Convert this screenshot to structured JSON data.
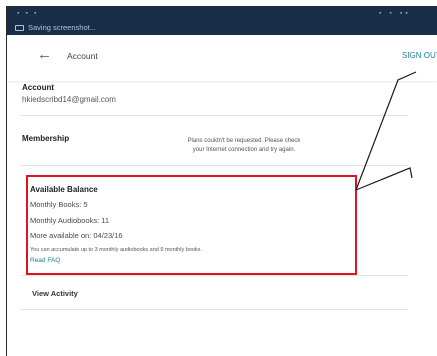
{
  "statusbar": {
    "notification_text": "Saving screenshot..."
  },
  "appbar": {
    "title": "Account",
    "sign_out_label": "SIGN OUT"
  },
  "account": {
    "label": "Account",
    "email": "hkiedscribd14@gmail.com"
  },
  "membership": {
    "label": "Membership",
    "message_line1": "Plans couldn't be requested. Please check",
    "message_line2": "your Internet connection and try again."
  },
  "balance": {
    "title": "Available Balance",
    "monthly_books": "Monthly Books: 5",
    "monthly_audiobooks": "Monthly Audiobooks: 11",
    "more_available": "More available on: 04/23/16",
    "note": "You can accumulate up to 3 monthly audiobooks and 9 monthly books.",
    "faq_link": "Read FAQ"
  },
  "activity": {
    "label": "View Activity"
  },
  "colors": {
    "statusbar": "#172d48",
    "link": "#1e7ea3",
    "highlight": "#e0141e"
  },
  "icons": [
    "back-arrow-icon",
    "screenshot-notification-icon"
  ]
}
